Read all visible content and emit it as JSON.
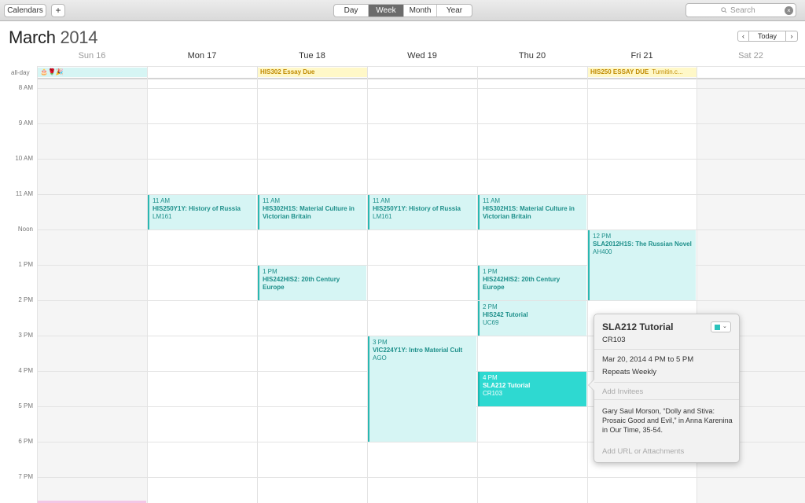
{
  "toolbar": {
    "calendars_label": "Calendars",
    "add_label": "+",
    "views": [
      "Day",
      "Week",
      "Month",
      "Year"
    ],
    "active_view": "Week",
    "search_placeholder": "Search"
  },
  "header": {
    "month": "March",
    "year": "2014",
    "today_label": "Today",
    "prev_label": "‹",
    "next_label": "›"
  },
  "days": [
    "Sun 16",
    "Mon 17",
    "Tue 18",
    "Wed 19",
    "Thu 20",
    "Fri 21",
    "Sat 22"
  ],
  "allday_label": "all-day",
  "times": [
    "8 AM",
    "9 AM",
    "10 AM",
    "11 AM",
    "Noon",
    "1 PM",
    "2 PM",
    "3 PM",
    "4 PM",
    "5 PM",
    "6 PM",
    "7 PM"
  ],
  "allday_events": [
    {
      "day": 0,
      "title": "🎂🌹🎉",
      "color": "#d6f5f4",
      "style": "teal"
    },
    {
      "day": 2,
      "title": "HIS302 Essay Due",
      "style": "yellow"
    },
    {
      "day": 5,
      "title": "HIS250 ESSAY DUE",
      "extra": "Turnitin.c...",
      "style": "yellow"
    }
  ],
  "events": [
    {
      "day": 1,
      "start": 11,
      "end": 12,
      "time": "11 AM",
      "title": "HIS250Y1Y: History of Russia",
      "location": "LM161"
    },
    {
      "day": 2,
      "start": 11,
      "end": 12,
      "time": "11 AM",
      "title": "HIS302H1S: Material Culture in Victorian Britain",
      "location": ""
    },
    {
      "day": 3,
      "start": 11,
      "end": 12,
      "time": "11 AM",
      "title": "HIS250Y1Y: History of Russia",
      "location": "LM161"
    },
    {
      "day": 4,
      "start": 11,
      "end": 12,
      "time": "11 AM",
      "title": "HIS302H1S: Material Culture in Victorian Britain",
      "location": ""
    },
    {
      "day": 5,
      "start": 12,
      "end": 14,
      "time": "12 PM",
      "title": "SLA2012H1S: The Russian Novel",
      "location": "AH400"
    },
    {
      "day": 2,
      "start": 13,
      "end": 14,
      "time": "1 PM",
      "title": "HIS242HIS2: 20th Century Europe",
      "location": ""
    },
    {
      "day": 4,
      "start": 13,
      "end": 14,
      "time": "1 PM",
      "title": "HIS242HIS2: 20th Century Europe",
      "location": ""
    },
    {
      "day": 4,
      "start": 14,
      "end": 15,
      "time": "2 PM",
      "title": "HIS242 Tutorial",
      "location": "UC69"
    },
    {
      "day": 3,
      "start": 15,
      "end": 18,
      "time": "3 PM",
      "title": "VIC224Y1Y: Intro Material Cult",
      "location": "AGO"
    },
    {
      "day": 4,
      "start": 16,
      "end": 17,
      "time": "4 PM",
      "title": "SLA212 Tutorial",
      "location": "CR103",
      "selected": true
    }
  ],
  "popover": {
    "title": "SLA212 Tutorial",
    "location": "CR103",
    "datetime": "Mar 20, 2014  4 PM to 5 PM",
    "repeat": "Repeats Weekly",
    "invitees_placeholder": "Add Invitees",
    "notes": "Gary Saul Morson, “Dolly and Stiva: Prosaic Good and Evil,” in Anna Karenina in Our Time, 35-54.",
    "url_placeholder": "Add URL or Attachments",
    "calendar_color": "#2bc3bc"
  },
  "colors": {
    "event_bg": "#d6f5f4",
    "event_accent": "#2bb7b1",
    "selected_bg": "#2ed9d1",
    "allday_yellow": "#fff8c8"
  }
}
